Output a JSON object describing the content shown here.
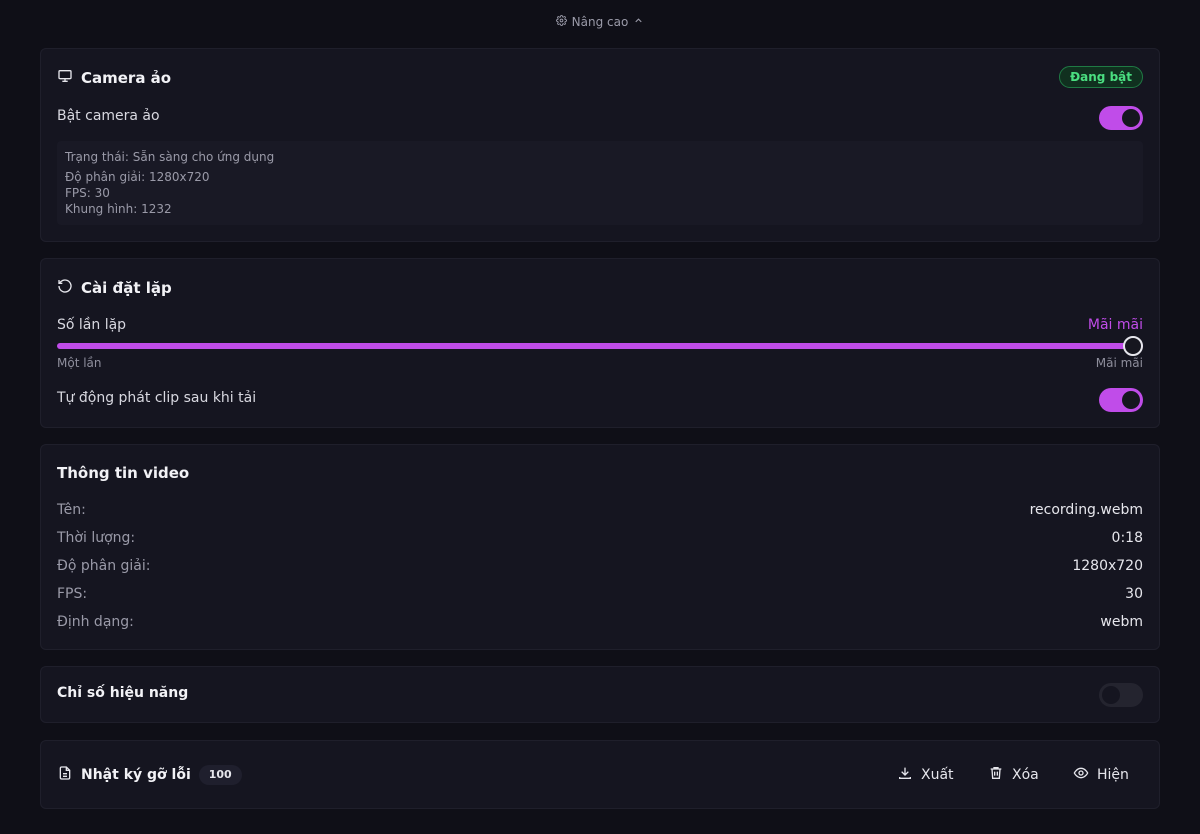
{
  "advanced": {
    "label": "Nâng cao",
    "icon": "gear-icon"
  },
  "virtual_camera": {
    "title": "Camera ảo",
    "badge": "Đang bật",
    "toggle_label": "Bật camera ảo",
    "enabled": true,
    "status": {
      "state": "Trạng thái: Sẵn sàng cho ứng dụng",
      "resolution": "Độ phân giải: 1280x720",
      "fps": "FPS: 30",
      "frames": "Khung hình: 1232"
    }
  },
  "loop_settings": {
    "title": "Cài đặt lặp",
    "count_label": "Số lần lặp",
    "count_value": "Mãi mãi",
    "min_label": "Một lần",
    "max_label": "Mãi mãi",
    "slider_level": 1.0,
    "autoplay_label": "Tự động phát clip sau khi tải",
    "autoplay_enabled": true
  },
  "video_info": {
    "title": "Thông tin video",
    "rows": [
      {
        "key": "Tên:",
        "value": "recording.webm"
      },
      {
        "key": "Thời lượng:",
        "value": "0:18"
      },
      {
        "key": "Độ phân giải:",
        "value": "1280x720"
      },
      {
        "key": "FPS:",
        "value": "30"
      },
      {
        "key": "Định dạng:",
        "value": "webm"
      }
    ]
  },
  "performance": {
    "title": "Chỉ số hiệu năng",
    "enabled": false
  },
  "debug_log": {
    "title": "Nhật ký gỡ lỗi",
    "count": "100",
    "export_label": "Xuất",
    "clear_label": "Xóa",
    "show_label": "Hiện"
  },
  "colors": {
    "accent": "#c04ce9",
    "success": "#4ade80",
    "background": "#0f0f17",
    "card": "#151520"
  }
}
